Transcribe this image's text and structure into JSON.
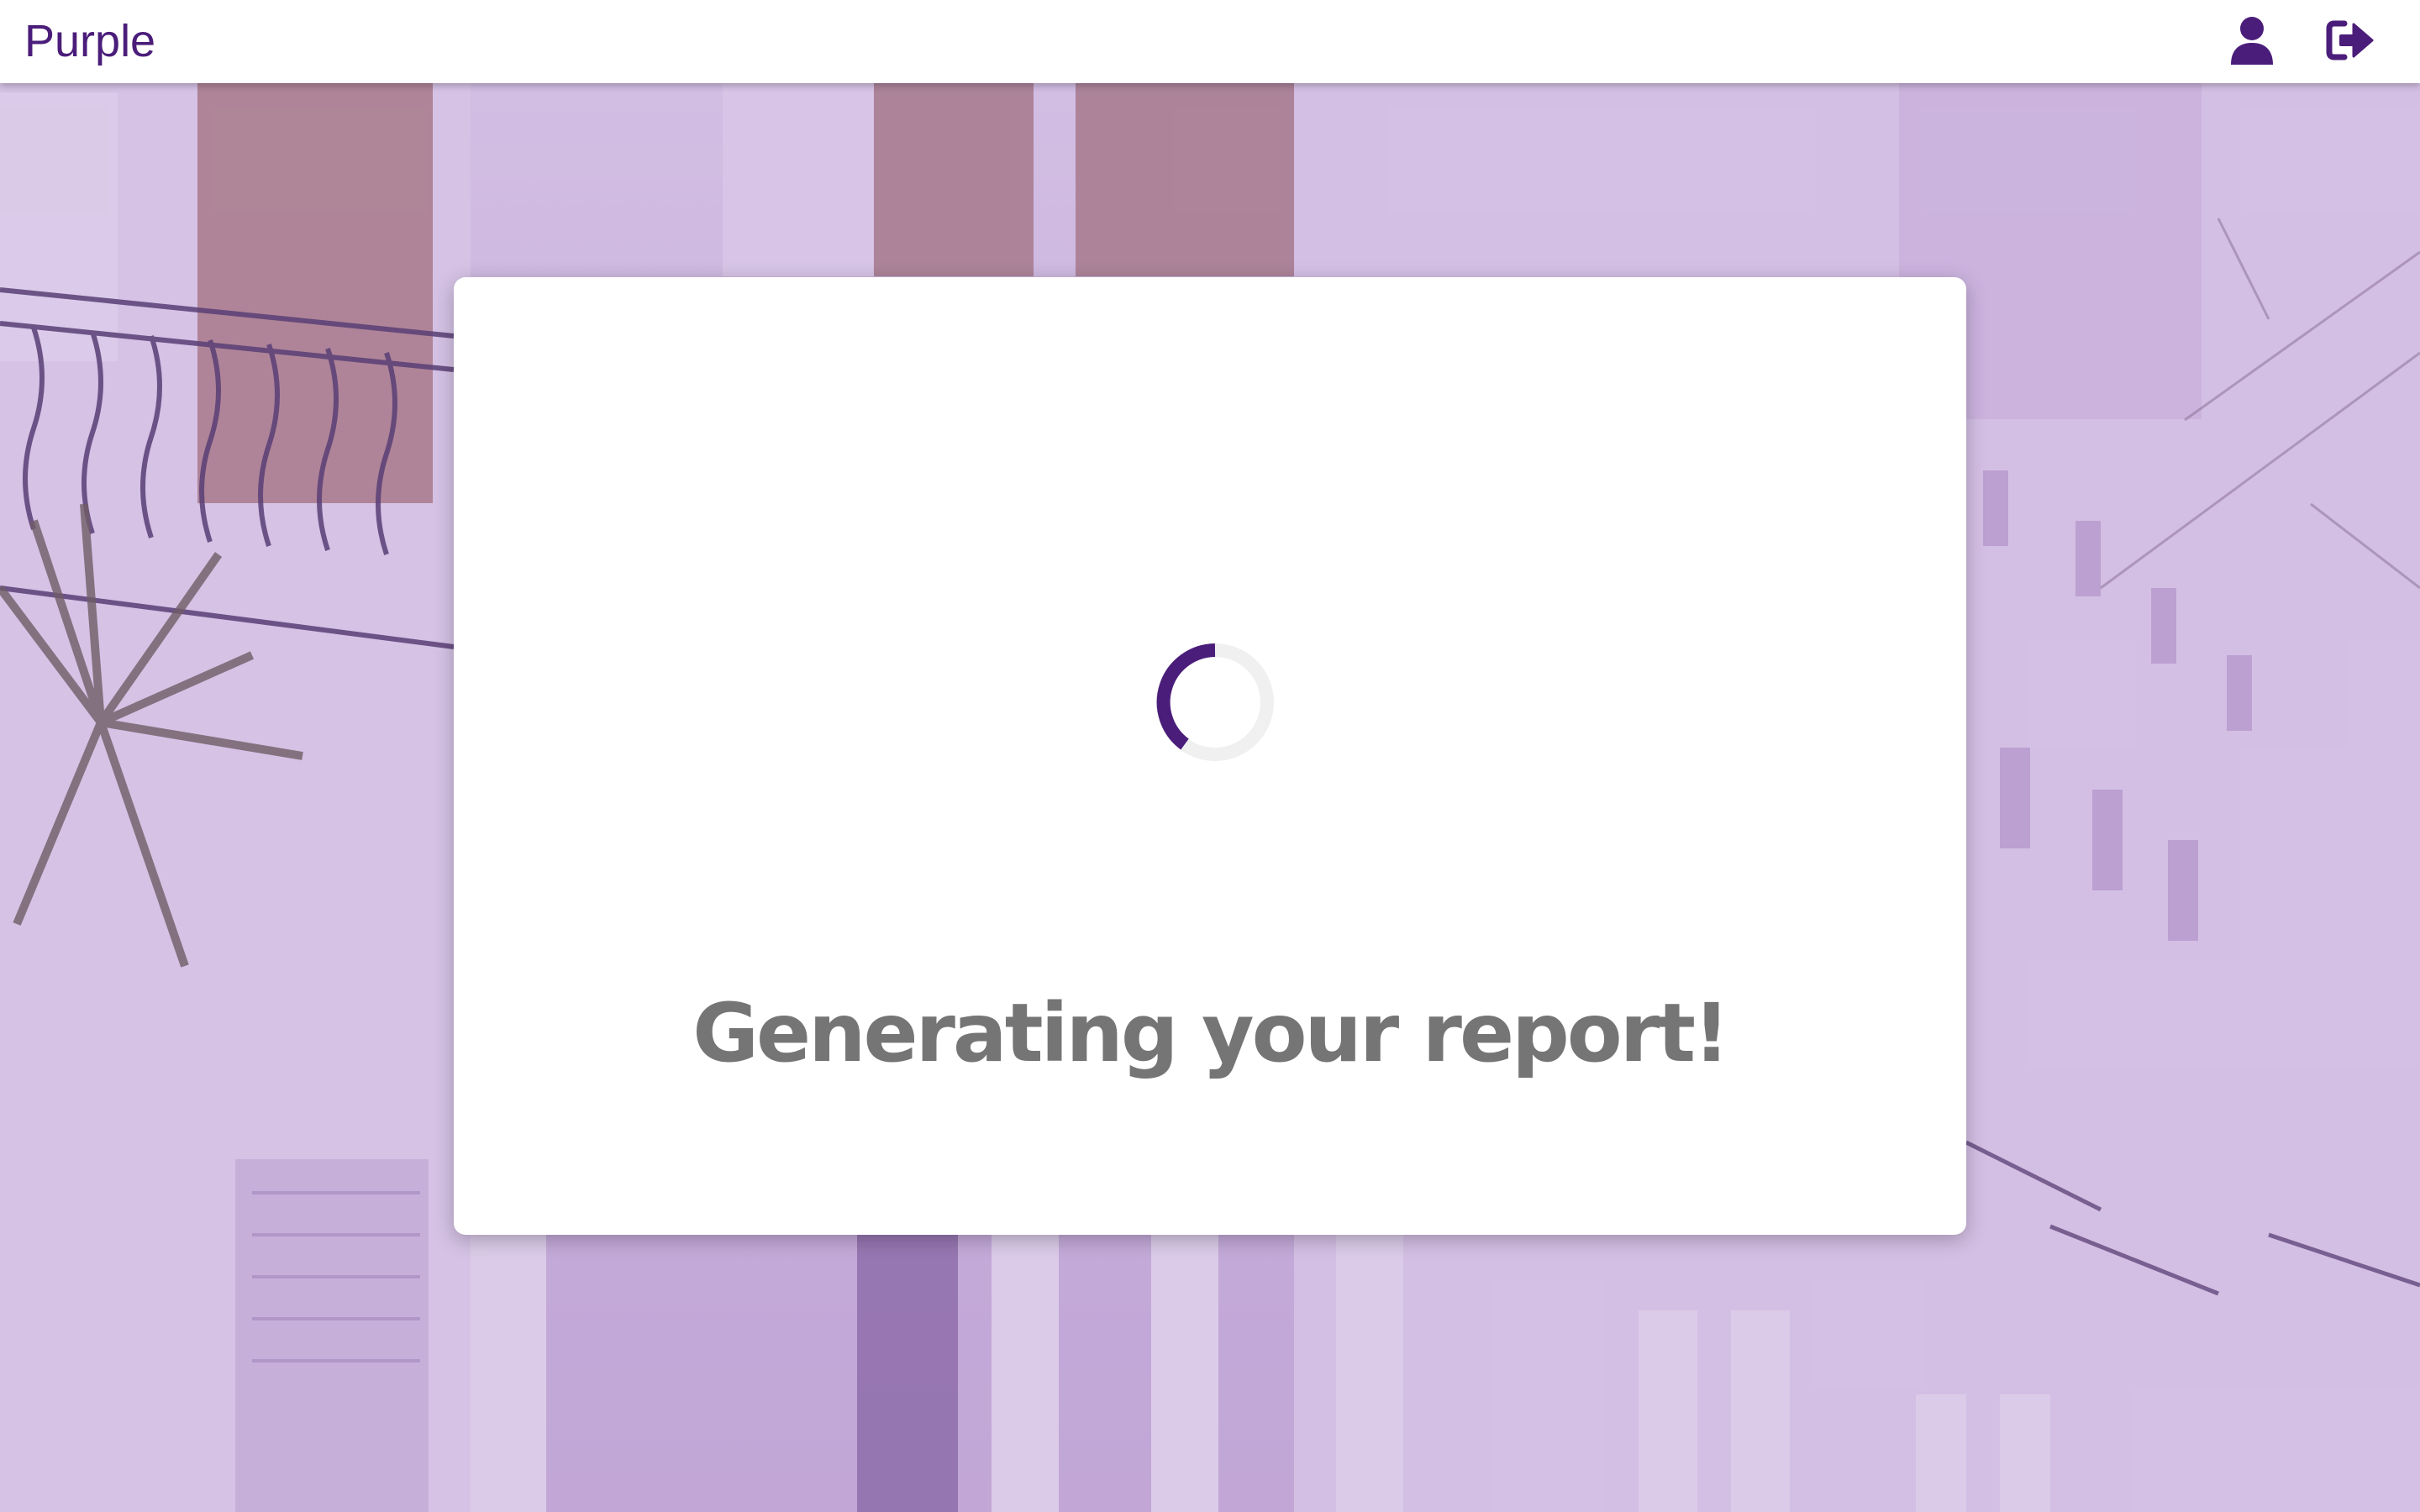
{
  "app": {
    "brand": "Purple",
    "brand_color": "#4b1d7a"
  },
  "header": {
    "icons": [
      "user-icon",
      "logout-icon"
    ]
  },
  "modal": {
    "message": "Generating your report!",
    "spinner_color": "#4b1d7a",
    "spinner_track_color": "#f0f0f0"
  },
  "background": {
    "subject": "photo",
    "tint_color": "#a078c8"
  }
}
